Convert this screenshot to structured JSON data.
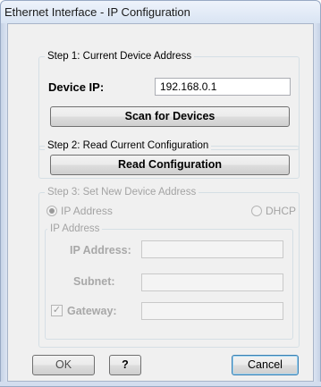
{
  "window": {
    "title": "Ethernet Interface - IP Configuration"
  },
  "step1": {
    "legend": "Step 1: Current Device Address",
    "device_ip_label": "Device IP:",
    "device_ip_value": "192.168.0.1",
    "scan_button": "Scan for Devices"
  },
  "step2": {
    "legend": "Step 2: Read Current Configuration",
    "read_button": "Read Configuration"
  },
  "step3": {
    "legend": "Step 3: Set New Device Address",
    "radio_ip": {
      "label": "IP Address",
      "checked": true,
      "enabled": false
    },
    "radio_dhcp": {
      "label": "DHCP",
      "checked": false,
      "enabled": false
    },
    "ip_group": {
      "legend": "IP Address",
      "ip_label": "IP Address:",
      "ip_value": "",
      "subnet_label": "Subnet:",
      "subnet_value": "",
      "gateway_label": "Gateway:",
      "gateway_checked": true,
      "gateway_value": ""
    }
  },
  "footer": {
    "ok_button": "OK",
    "help_button": "?",
    "cancel_button": "Cancel"
  }
}
